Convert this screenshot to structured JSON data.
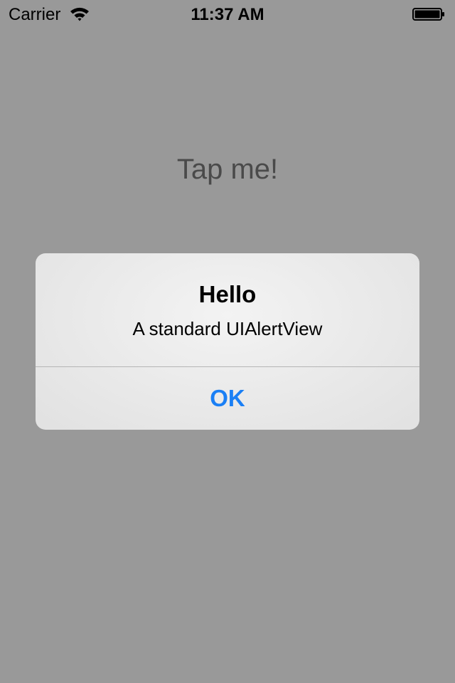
{
  "status_bar": {
    "carrier": "Carrier",
    "wifi_icon": "wifi-icon",
    "time": "11:37 AM",
    "battery_icon": "battery-icon",
    "battery_level": 1.0
  },
  "main": {
    "button_label": "Tap me!"
  },
  "alert": {
    "title": "Hello",
    "message": "A standard UIAlertView",
    "ok_label": "OK",
    "accent_color": "#1a7ff5"
  },
  "colors": {
    "dimmed_background": "#999999",
    "alert_background": "#e9e9e9"
  }
}
